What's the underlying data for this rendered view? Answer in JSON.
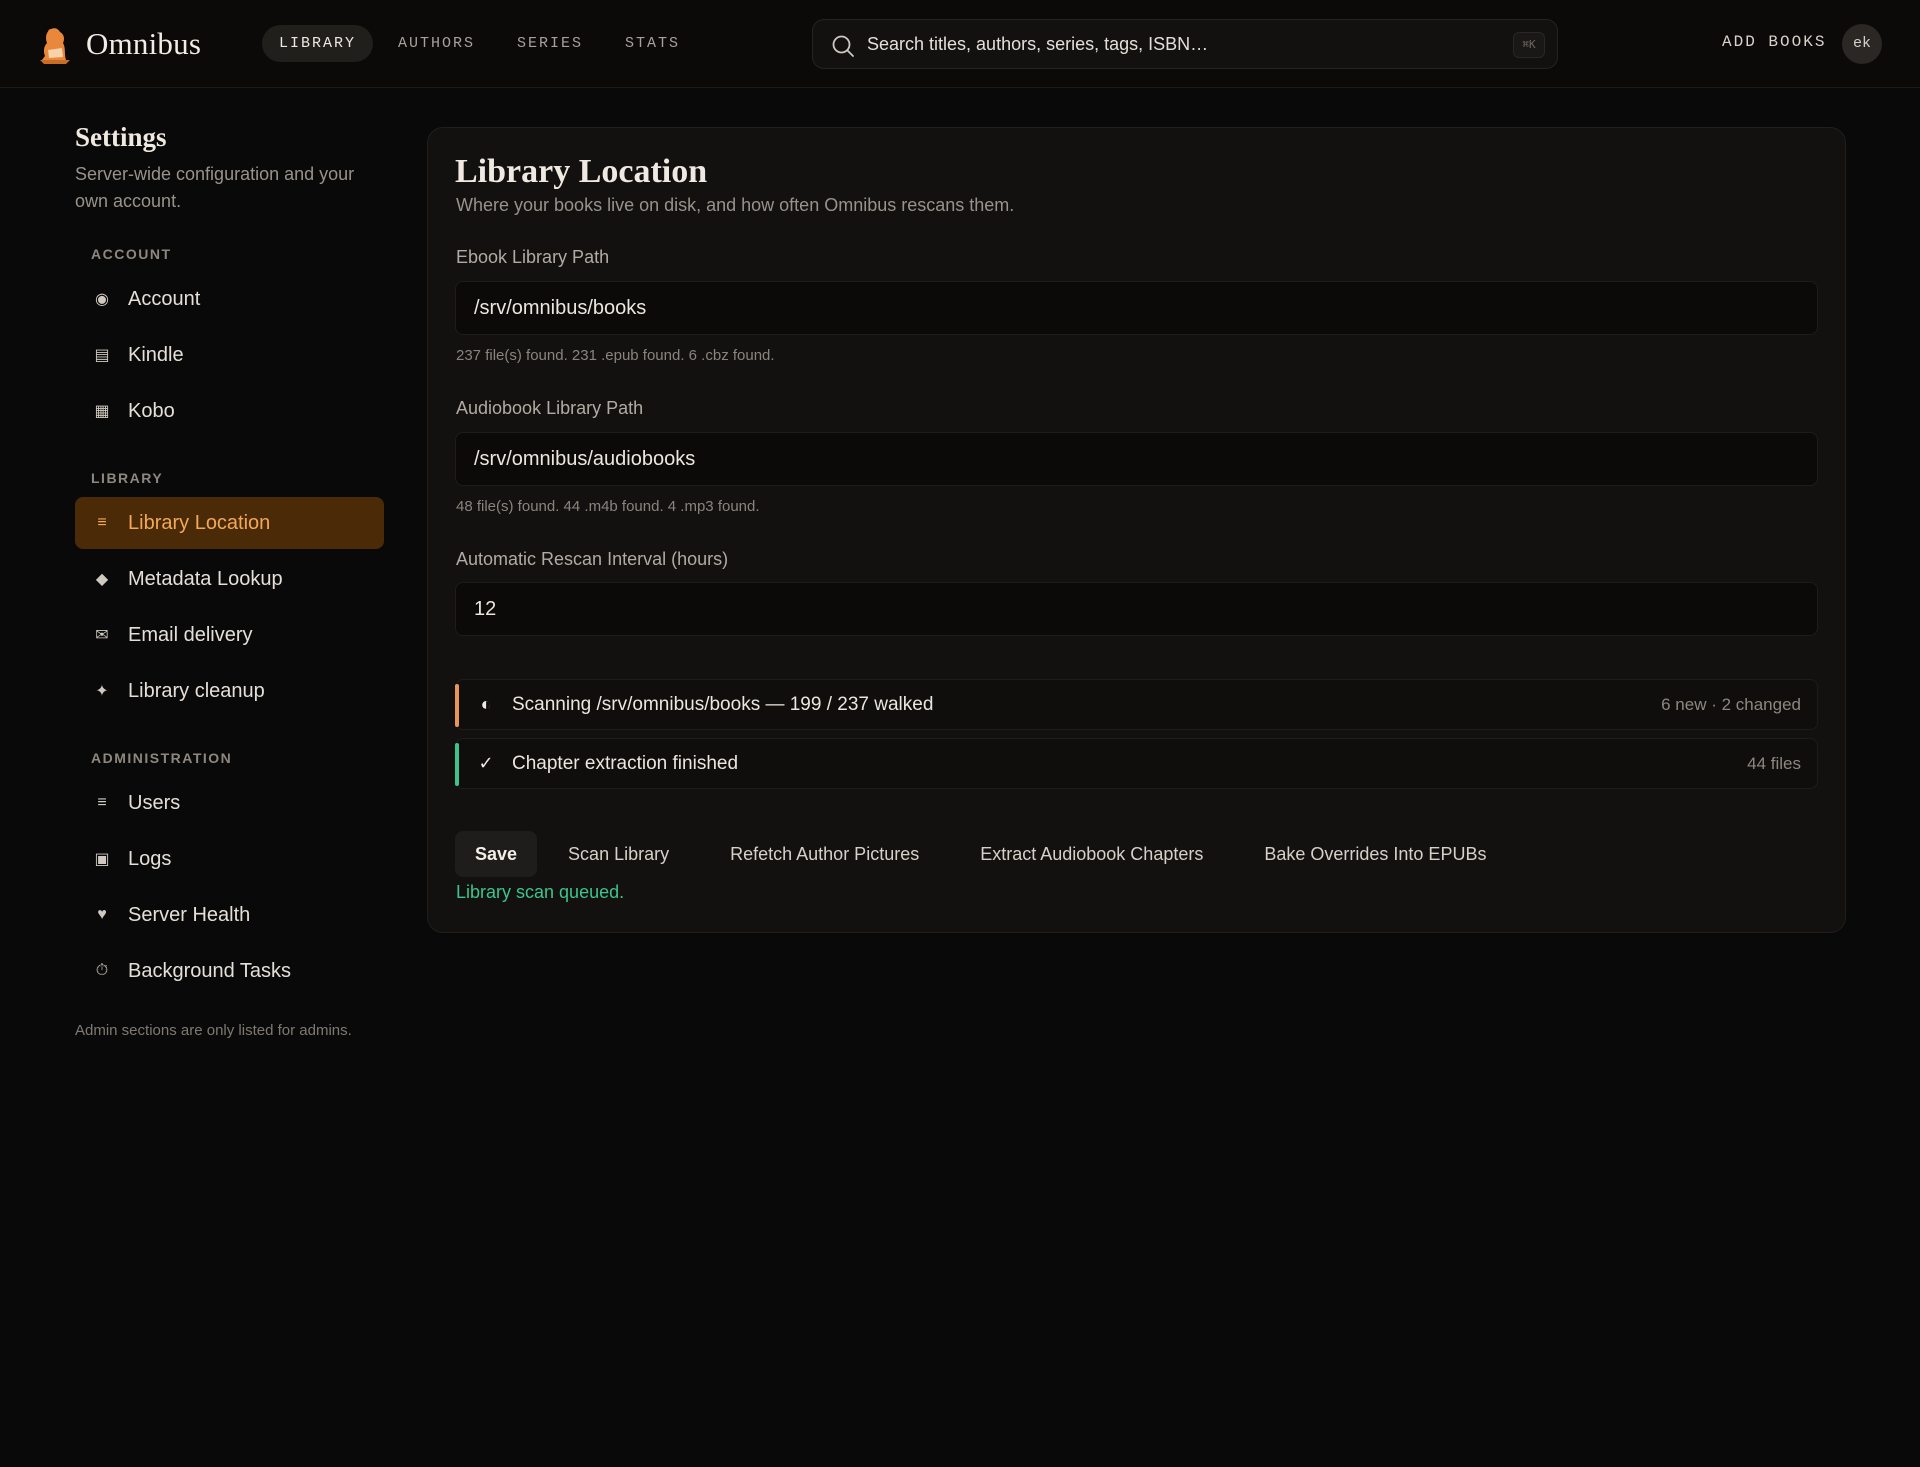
{
  "app": {
    "name": "Omnibus",
    "logo_icon": "bear-reading-logo-icon"
  },
  "nav": {
    "items": [
      {
        "label": "LIBRARY",
        "active": true
      },
      {
        "label": "AUTHORS",
        "active": false
      },
      {
        "label": "SERIES",
        "active": false
      },
      {
        "label": "STATS",
        "active": false
      }
    ]
  },
  "search": {
    "placeholder": "Search titles, authors, series, tags, ISBN…",
    "shortcut": "⌘K",
    "icon": "search-icon"
  },
  "header_actions": {
    "add_books_label": "ADD BOOKS",
    "avatar_initials": "ek"
  },
  "sidebar": {
    "title": "Settings",
    "subtitle": "Server-wide configuration and your own account.",
    "sections": [
      {
        "heading": "ACCOUNT",
        "items": [
          {
            "label": "Account",
            "icon": "radio-dot-icon",
            "glyph": "◉",
            "active": false
          },
          {
            "label": "Kindle",
            "icon": "tablet-icon",
            "glyph": "▤",
            "active": false
          },
          {
            "label": "Kobo",
            "icon": "grid-square-icon",
            "glyph": "▦",
            "active": false
          }
        ]
      },
      {
        "heading": "LIBRARY",
        "items": [
          {
            "label": "Library Location",
            "icon": "lines-icon",
            "glyph": "≡",
            "active": true
          },
          {
            "label": "Metadata Lookup",
            "icon": "diamond-icon",
            "glyph": "◆",
            "active": false
          },
          {
            "label": "Email delivery",
            "icon": "envelope-icon",
            "glyph": "✉",
            "active": false
          },
          {
            "label": "Library cleanup",
            "icon": "sparkle-icon",
            "glyph": "✦",
            "active": false
          }
        ]
      },
      {
        "heading": "ADMINISTRATION",
        "items": [
          {
            "label": "Users",
            "icon": "list-icon",
            "glyph": "≡",
            "active": false
          },
          {
            "label": "Logs",
            "icon": "square-log-icon",
            "glyph": "▣",
            "active": false
          },
          {
            "label": "Server Health",
            "icon": "heart-icon",
            "glyph": "♥",
            "active": false
          },
          {
            "label": "Background Tasks",
            "icon": "stopwatch-icon",
            "glyph": "⏱",
            "active": false
          }
        ]
      }
    ],
    "footnote": "Admin sections are only listed for admins."
  },
  "card": {
    "title": "Library Location",
    "subtitle": "Where your books live on disk, and how often Omnibus rescans them.",
    "fields": {
      "ebook": {
        "label": "Ebook Library Path",
        "value": "/srv/omnibus/books",
        "hint": "237 file(s) found. 231 .epub found. 6 .cbz found."
      },
      "audiobook": {
        "label": "Audiobook Library Path",
        "value": "/srv/omnibus/audiobooks",
        "hint": "48 file(s) found. 44 .m4b found. 4 .mp3 found."
      },
      "rescan": {
        "label": "Automatic Rescan Interval (hours)",
        "value": "12"
      }
    },
    "statuses": [
      {
        "text": "Scanning /srv/omnibus/books — 199 / 237 walked",
        "meta": "6 new · 2 changed",
        "icon": "half-circle-progress-icon",
        "glyph": "◐",
        "accent": "#e8955a"
      },
      {
        "text": "Chapter extraction finished",
        "meta": "44 files",
        "icon": "check-icon",
        "glyph": "✓",
        "accent": "#3cc48b"
      }
    ],
    "actions": {
      "save": "Save",
      "scan": "Scan Library",
      "refetch": "Refetch Author Pictures",
      "extract": "Extract Audiobook Chapters",
      "bake": "Bake Overrides Into EPUBs"
    },
    "message": "Library scan queued."
  },
  "colors": {
    "background": "#0a0909",
    "card": "#121110",
    "accent": "#f2a85a",
    "active_bg": "#4a2a07",
    "success": "#3cc48b"
  }
}
